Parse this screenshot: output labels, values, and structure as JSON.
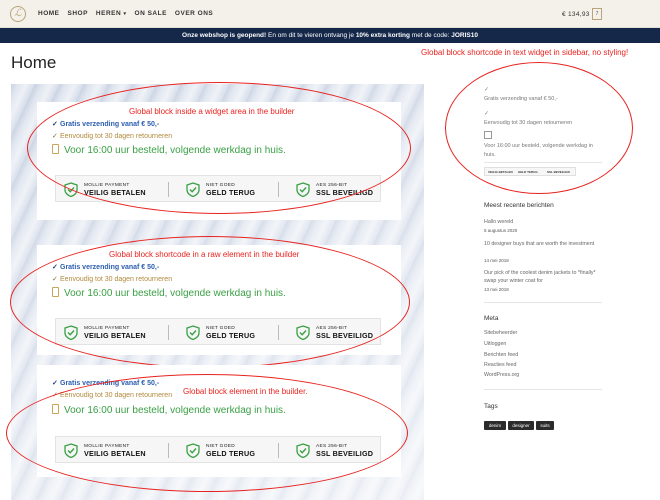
{
  "nav": {
    "logo": "ℒ",
    "items": [
      {
        "label": "HOME"
      },
      {
        "label": "SHOP"
      },
      {
        "label": "HEREN"
      },
      {
        "label": "ON SALE"
      },
      {
        "label": "OVER ONS"
      }
    ],
    "heren_caret": "▾",
    "cart_amount": "€ 134,93",
    "cart_count": "7"
  },
  "announcement": {
    "part1": "Onze webshop is geopend!",
    "part2": " En om dit te vieren ontvang je ",
    "discount": "10% extra korting",
    "part3": " met de code: ",
    "code": "JORIS10"
  },
  "page": {
    "title": "Home"
  },
  "notes": {
    "sidebar": "Global block shortcode in text widget in sidebar, no styling!",
    "block1": "Global block inside a widget area in the builder",
    "block2": "Global block shortcode in a raw element in the builder",
    "block3": "Global block element in the builder."
  },
  "usp": {
    "shipping": "Gratis verzending vanaf € 50,-",
    "returns": "Eenvoudig tot 30 dagen retourneren",
    "delivery": "Voor 16:00 uur besteld, volgende werkdag in huis.",
    "check": "✓"
  },
  "trust": {
    "mollie_small": "MOLLIE PAYMENT",
    "mollie_big": "VEILIG BETALEN",
    "money_small": "NIET GOED",
    "money_big": "GELD TERUG",
    "ssl_small": "AES 256-BIT",
    "ssl_big": "SSL BEVEILIGD"
  },
  "sidebar": {
    "usp_shipping": "Gratis verzending vanaf € 50,-",
    "usp_returns": "Eenvoudig tot 30 dagen retourneren",
    "usp_delivery": "Voor 16:00 uur besteld, volgende werkdag in huis.",
    "recent_title": "Meest recente berichten",
    "posts": [
      {
        "title": "Hallo wereld",
        "date": "5 augustus 2020"
      },
      {
        "title": "10 designer buys that are worth the investment",
        "date": "14 mei 2018"
      },
      {
        "title": "Our pick of the coolest denim jackets to *finally* swap your winter coat for",
        "date": "13 mei 2018"
      }
    ],
    "meta_title": "Meta",
    "meta_links": [
      "Sitebeheerder",
      "Uitloggen",
      "Berichten feed",
      "Reacties feed",
      "WordPress.org"
    ],
    "tags_title": "Tags",
    "tags": [
      "denim",
      "designer",
      "suits"
    ]
  },
  "colors": {
    "accent_red": "#e8231f",
    "navy": "#15284a",
    "usp_blue": "#2a5db0",
    "usp_gold": "#b18a3c",
    "usp_green": "#3aa045"
  }
}
